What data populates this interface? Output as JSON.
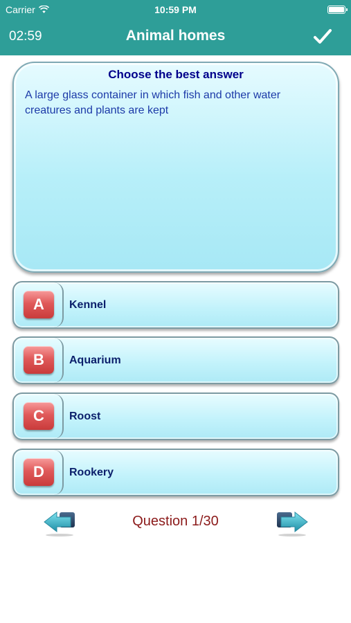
{
  "status_bar": {
    "carrier": "Carrier",
    "time": "10:59 PM",
    "wifi_icon": "wifi-icon",
    "battery_icon": "battery-icon"
  },
  "nav_bar": {
    "timer": "02:59",
    "title": "Animal homes",
    "submit_icon": "checkmark-icon",
    "background_color": "#2e9e98"
  },
  "question": {
    "heading": "Choose the best answer",
    "text": "A large glass container in which fish and other water creatures and plants are kept"
  },
  "answers": [
    {
      "letter": "A",
      "label": "Kennel"
    },
    {
      "letter": "B",
      "label": "Aquarium"
    },
    {
      "letter": "C",
      "label": "Roost"
    },
    {
      "letter": "D",
      "label": "Rookery"
    }
  ],
  "footer": {
    "counter": "Question 1/30",
    "prev_icon": "arrow-left-icon",
    "next_icon": "arrow-right-icon"
  },
  "colors": {
    "accent": "#2e9e98",
    "letter_badge": "#e05a5a",
    "counter_text": "#8b1a1a"
  }
}
